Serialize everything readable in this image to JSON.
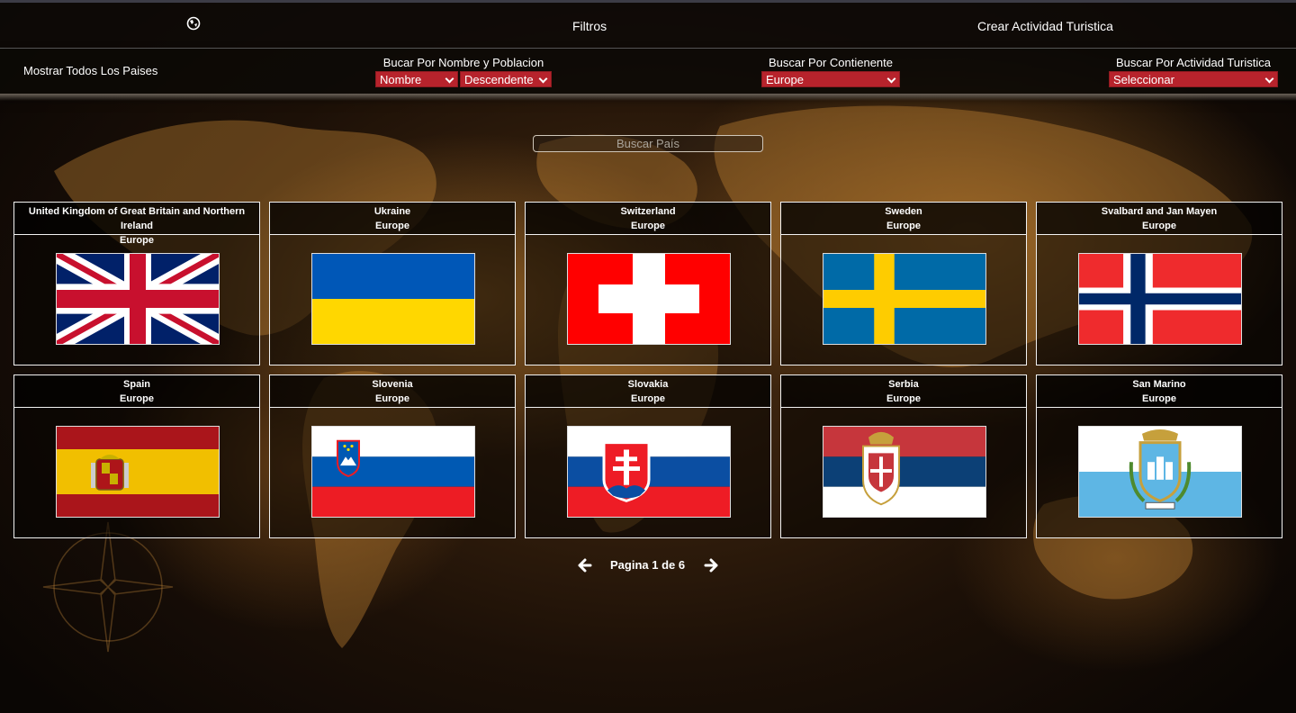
{
  "nav": {
    "filters_label": "Filtros",
    "create_activity_label": "Crear Actividad Turistica"
  },
  "filters": {
    "show_all_label": "Mostrar Todos Los Paises",
    "name_population": {
      "label": "Bucar Por Nombre y Poblacion",
      "sort_field": "Nombre",
      "sort_order": "Descendente"
    },
    "continent": {
      "label": "Buscar Por Contienente",
      "selected": "Europe"
    },
    "activity": {
      "label": "Buscar Por Actividad Turistica",
      "selected": "Seleccionar"
    }
  },
  "search": {
    "placeholder": "Buscar País"
  },
  "countries": [
    {
      "name": "United Kingdom of Great Britain and Northern Ireland",
      "continent": "Europe",
      "flag": "gb"
    },
    {
      "name": "Ukraine",
      "continent": "Europe",
      "flag": "ua"
    },
    {
      "name": "Switzerland",
      "continent": "Europe",
      "flag": "ch"
    },
    {
      "name": "Sweden",
      "continent": "Europe",
      "flag": "se"
    },
    {
      "name": "Svalbard and Jan Mayen",
      "continent": "Europe",
      "flag": "sj"
    },
    {
      "name": "Spain",
      "continent": "Europe",
      "flag": "es"
    },
    {
      "name": "Slovenia",
      "continent": "Europe",
      "flag": "si"
    },
    {
      "name": "Slovakia",
      "continent": "Europe",
      "flag": "sk"
    },
    {
      "name": "Serbia",
      "continent": "Europe",
      "flag": "rs"
    },
    {
      "name": "San Marino",
      "continent": "Europe",
      "flag": "sm"
    }
  ],
  "pagination": {
    "text": "Pagina 1 de 6"
  },
  "colors": {
    "accent": "#b7232c",
    "card_border": "#f2f2f2"
  }
}
